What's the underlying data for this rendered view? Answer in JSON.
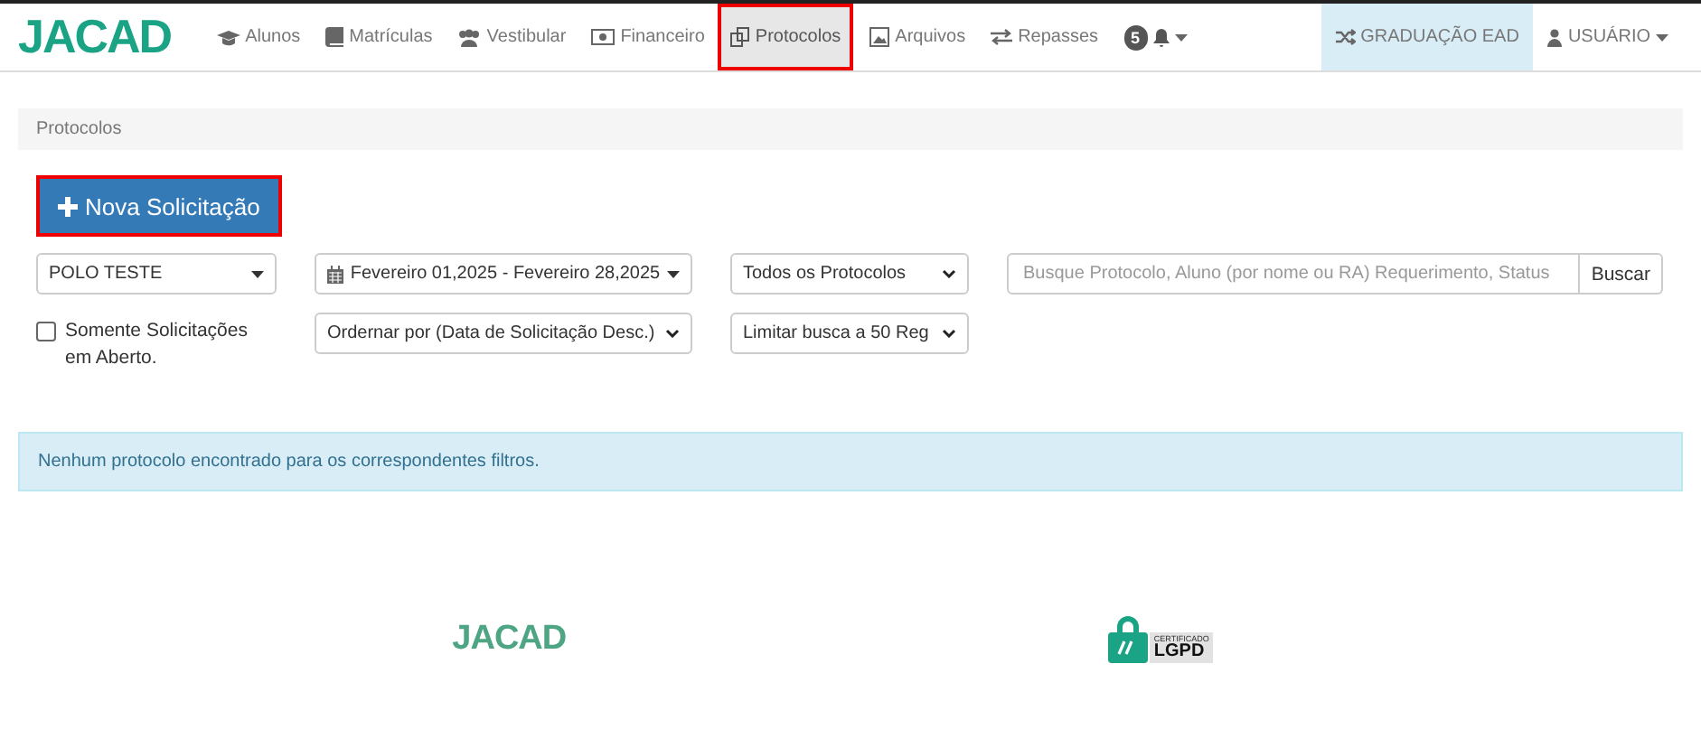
{
  "brand": {
    "logo": "JACAD"
  },
  "nav": [
    {
      "label": "Alunos",
      "selected": false,
      "highlighted": false
    },
    {
      "label": "Matrículas",
      "selected": false,
      "highlighted": false
    },
    {
      "label": "Vestibular",
      "selected": false,
      "highlighted": false
    },
    {
      "label": "Financeiro",
      "selected": false,
      "highlighted": false
    },
    {
      "label": "Protocolos",
      "selected": true,
      "highlighted": true
    },
    {
      "label": "Arquivos",
      "selected": false,
      "highlighted": false
    },
    {
      "label": "Repasses",
      "selected": false,
      "highlighted": false
    }
  ],
  "notifications": {
    "count": "5"
  },
  "nav_right": [
    {
      "label": "GRADUAÇÃO EAD",
      "selected": true
    },
    {
      "label": "USUÁRIO",
      "selected": false
    }
  ],
  "breadcrumb": "Protocolos",
  "new_button": {
    "label": "Nova Solicitação",
    "highlighted": true
  },
  "filters": {
    "polo": "POLO TESTE",
    "date_range": "Fevereiro 01,2025 - Fevereiro 28,2025",
    "type": "Todos os Protocolos",
    "search": {
      "placeholder": "Busque Protocolo, Aluno (por nome ou RA) Requerimento, Status",
      "button": "Buscar"
    },
    "open_only": {
      "label": "Somente Solicitações em Aberto.",
      "checked": false
    },
    "order": "Ordernar por (Data de Solicitação Desc.)",
    "limit": "Limitar busca a 50 Reg"
  },
  "alert": "Nenhum protocolo encontrado para os correspondentes filtros.",
  "footer": {
    "logo": "JACAD",
    "badge_top": "CERTIFICADO",
    "badge_main": "LGPD"
  }
}
